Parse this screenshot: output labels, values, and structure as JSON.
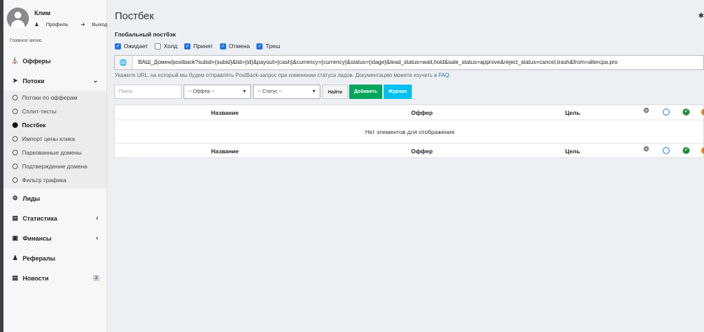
{
  "user": {
    "name": "Клим",
    "profile": "Профиль",
    "logout": "Выход"
  },
  "menu_header": "Главное меню",
  "menu": {
    "offers": "Офферы",
    "flows": "Потоки",
    "flows_sub": [
      "Потоки по офферам",
      "Сплит-тесты",
      "Постбек",
      "Импорт цены клика",
      "Паркованные домены",
      "Подтверждение домена",
      "Фильтр трафика"
    ],
    "leads": "Лиды",
    "stats": "Статистика",
    "finance": "Финансы",
    "referrals": "Рефералы",
    "news": "Новости",
    "news_badge": "2"
  },
  "page": {
    "title": "Постбек",
    "global_label": "Глобальный постбэк",
    "statuses": [
      "Ожидает",
      "Холд",
      "Принят",
      "Отмена",
      "Треш"
    ],
    "status_checked": [
      true,
      false,
      true,
      true,
      true
    ],
    "url": "ВАШ_Домен/postback?subid={subid}&tid={id}&payout={cash}&currency={currency}&status={stage}&lead_status=wait,hold&sale_status=approve&reject_status=cancel,trash&from=altercpa.pro",
    "hint": "Укажите URL, на который мы будем отправлять PostBack-запрос при изменении статуса лидов. Документацию можете изучить в ",
    "hint_link": "FAQ",
    "search_placeholder": "Поиск",
    "offer_select": "-- Оффер --",
    "status_select": "-- Статус --",
    "find_btn": "Найти",
    "add_btn": "Добавить",
    "log_btn": "Журнал"
  },
  "table": {
    "columns": [
      "Название",
      "Оффер",
      "Цель"
    ],
    "empty": "Нет элементов для отображения"
  },
  "colors": {
    "accent": "#1e73e8",
    "add": "#00a65a",
    "log": "#00c0ef",
    "sidebar": "#f7f7f7"
  }
}
